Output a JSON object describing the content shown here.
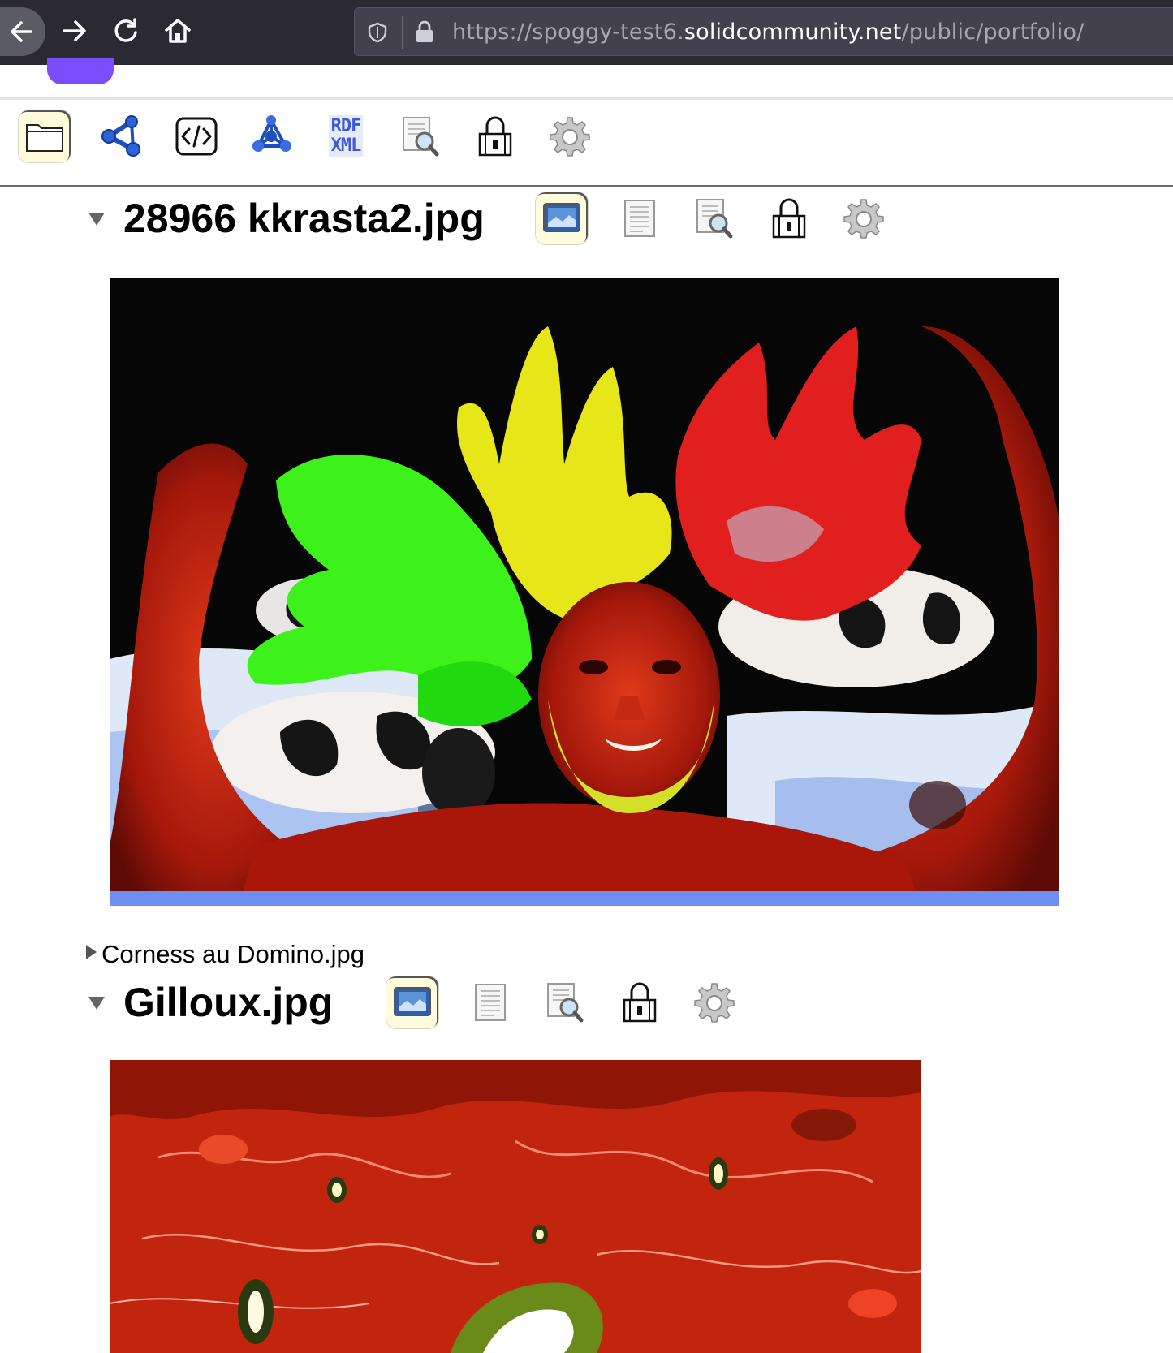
{
  "browser": {
    "url_scheme": "https://",
    "url_sub": "spoggy-test6.",
    "url_host": "solidcommunity.net",
    "url_path": "/public/portfolio/"
  },
  "toolbar": {
    "buttons": [
      {
        "name": "folder-icon",
        "selected": true
      },
      {
        "name": "graph-icon",
        "selected": false
      },
      {
        "name": "source-code-icon",
        "selected": false
      },
      {
        "name": "molecule-icon",
        "selected": false
      },
      {
        "name": "rdf-xml-icon",
        "label_top": "RDF",
        "label_bottom": "XML",
        "selected": false
      },
      {
        "name": "magnifier-document-icon",
        "selected": false
      },
      {
        "name": "padlock-icon",
        "selected": false
      },
      {
        "name": "gear-icon",
        "selected": false
      }
    ]
  },
  "sections": [
    {
      "title": "28966 kkrasta2.jpg",
      "expanded": true
    },
    {
      "title": "Corness au Domino.jpg",
      "expanded": false
    },
    {
      "title": "Gilloux.jpg",
      "expanded": true
    }
  ],
  "colors": {
    "chrome_bg": "#2b2a33",
    "urlbar_bg": "#42414d",
    "selected_button_bg": "#fffbdc",
    "app_accent": "#7c4dff"
  }
}
